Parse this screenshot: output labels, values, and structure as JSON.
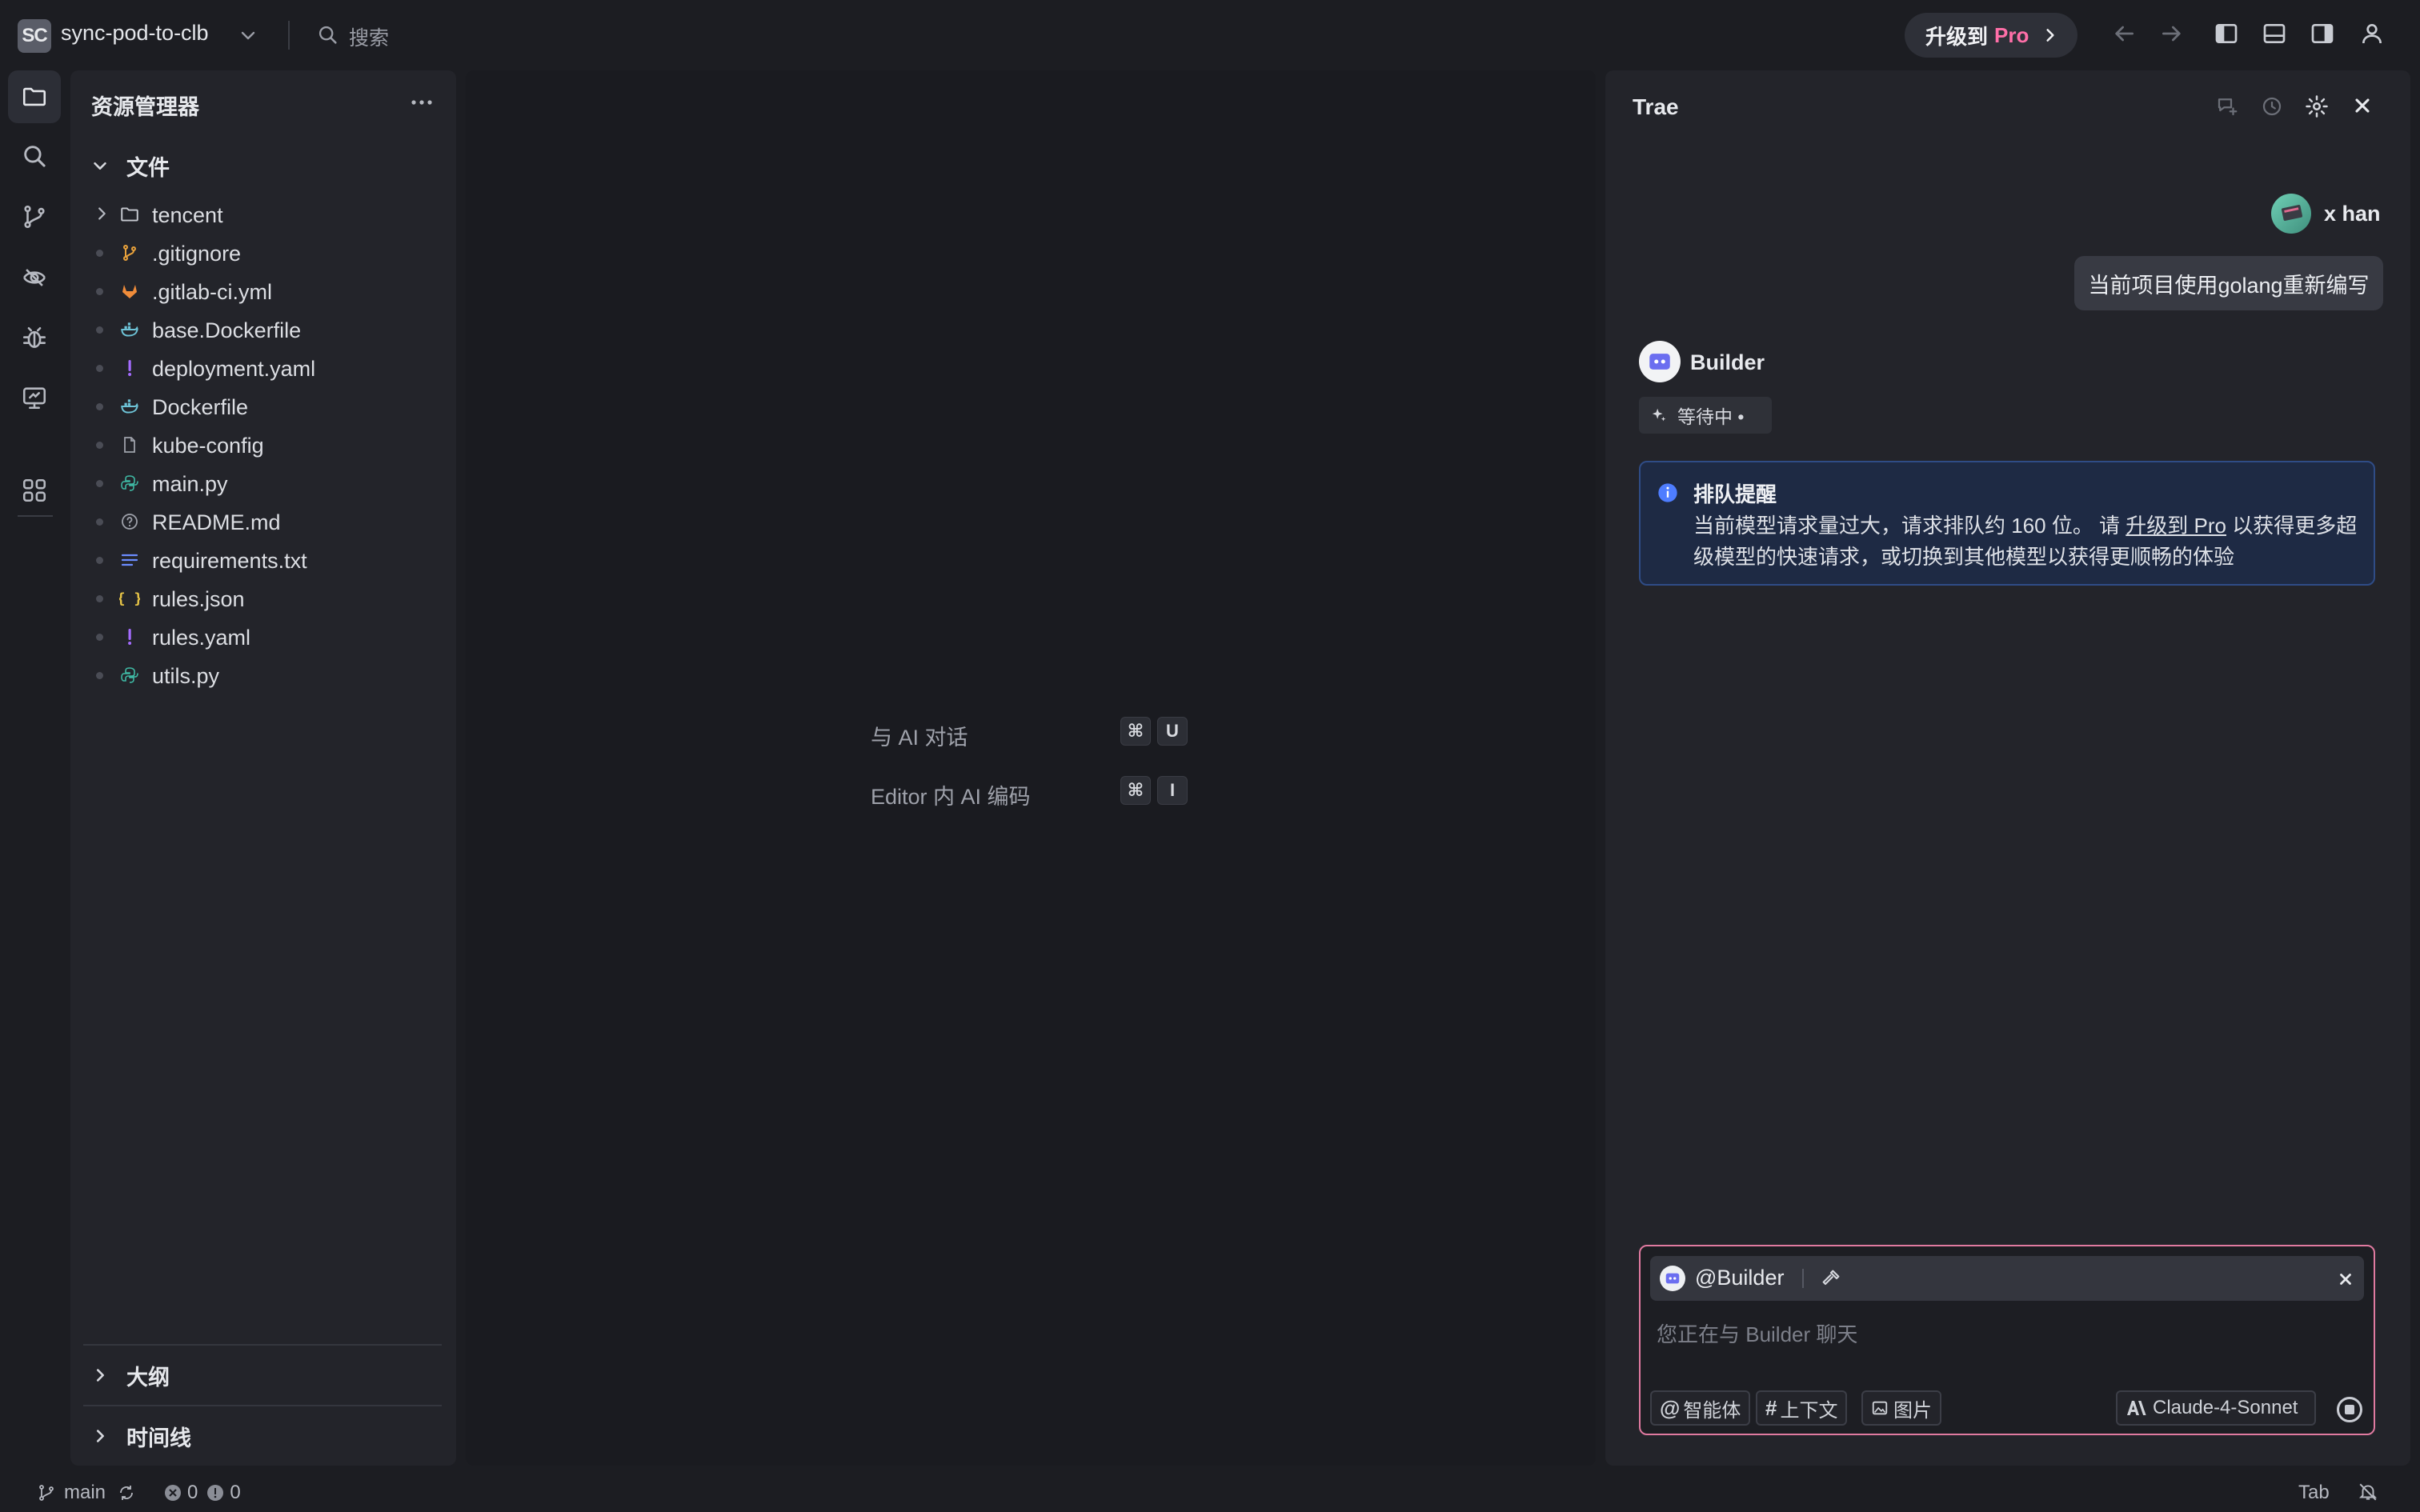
{
  "titlebar": {
    "project_badge": "SC",
    "project_name": "sync-pod-to-clb",
    "search_label": "搜索",
    "upgrade_text": "升级到",
    "upgrade_pro": "Pro"
  },
  "explorer": {
    "title": "资源管理器",
    "files_section": "文件",
    "items": [
      {
        "name": "tencent",
        "icon": "folder-icon",
        "color": "#c7cad1"
      },
      {
        "name": ".gitignore",
        "icon": "git-branch-icon",
        "color": "#e9a23b"
      },
      {
        "name": ".gitlab-ci.yml",
        "icon": "gitlab-icon",
        "color": "#f08c3a"
      },
      {
        "name": "base.Dockerfile",
        "icon": "docker-icon",
        "color": "#6ec4d8"
      },
      {
        "name": "deployment.yaml",
        "icon": "exclamation-icon",
        "color": "#a46cff"
      },
      {
        "name": "Dockerfile",
        "icon": "docker-icon",
        "color": "#6ec4d8"
      },
      {
        "name": "kube-config",
        "icon": "file-icon",
        "color": "#9ea1aa"
      },
      {
        "name": "main.py",
        "icon": "python-icon",
        "color": "#3fb9a4"
      },
      {
        "name": "README.md",
        "icon": "info-circle-icon",
        "color": "#9ea1aa"
      },
      {
        "name": "requirements.txt",
        "icon": "lines-icon",
        "color": "#6b8cff"
      },
      {
        "name": "rules.json",
        "icon": "braces-icon",
        "color": "#e8c547"
      },
      {
        "name": "rules.yaml",
        "icon": "exclamation-icon",
        "color": "#a46cff"
      },
      {
        "name": "utils.py",
        "icon": "python-icon",
        "color": "#3fb9a4"
      }
    ],
    "outline_section": "大纲",
    "timeline_section": "时间线"
  },
  "editor": {
    "hint1_label": "与 AI 对话",
    "hint1_key1": "⌘",
    "hint1_key2": "U",
    "hint2_label": "Editor 内 AI 编码",
    "hint2_key1": "⌘",
    "hint2_key2": "I"
  },
  "chat": {
    "title": "Trae",
    "user_name": "x han",
    "user_message": "当前项目使用golang重新编写",
    "bot_name": "Builder",
    "waiting": "等待中 •",
    "notice_title": "排队提醒",
    "notice_text_a": "当前模型请求量过大，请求排队约 160 位。 请 ",
    "notice_link": "升级到 Pro",
    "notice_text_b": " 以获得更多超级模型的快速请求，或切换到其他模型以获得更顺畅的体验",
    "mention": "@Builder",
    "placeholder": "您正在与 Builder 聊天",
    "btn_agent": "智能体",
    "btn_context": "上下文",
    "btn_image": "图片",
    "model": "Claude-4-Sonnet"
  },
  "statusbar": {
    "branch": "main",
    "errors": "0",
    "warnings": "0",
    "tab": "Tab"
  },
  "colors": {
    "accent_pink": "#ff6fa8",
    "notice_border": "#2f4c86",
    "input_border": "#e07aa0"
  }
}
